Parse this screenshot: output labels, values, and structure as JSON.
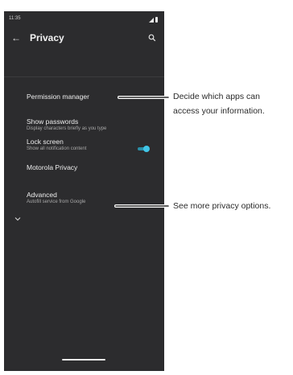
{
  "status_bar": {
    "time": "11:35"
  },
  "app_bar": {
    "title": "Privacy"
  },
  "settings": {
    "permission_manager": {
      "title": "Permission manager"
    },
    "show_passwords": {
      "title": "Show passwords",
      "subtitle": "Display characters briefly as you type",
      "enabled": true
    },
    "lock_screen": {
      "title": "Lock screen",
      "subtitle": "Show all notification content"
    },
    "motorola_privacy": {
      "title": "Motorola Privacy"
    },
    "advanced": {
      "title": "Advanced",
      "subtitle": "Autofill service from Google"
    }
  },
  "callouts": {
    "permission_line1": "Decide which apps can",
    "permission_line2": "access your information.",
    "advanced": "See more privacy options."
  },
  "colors": {
    "screen_background": "#2c2c2e",
    "toggle_accent": "#41c6e8",
    "callout_text": "#2b2b2b"
  },
  "icons": [
    "signal-icon",
    "battery-icon",
    "back-arrow-icon",
    "search-icon",
    "chevron-down-icon"
  ]
}
